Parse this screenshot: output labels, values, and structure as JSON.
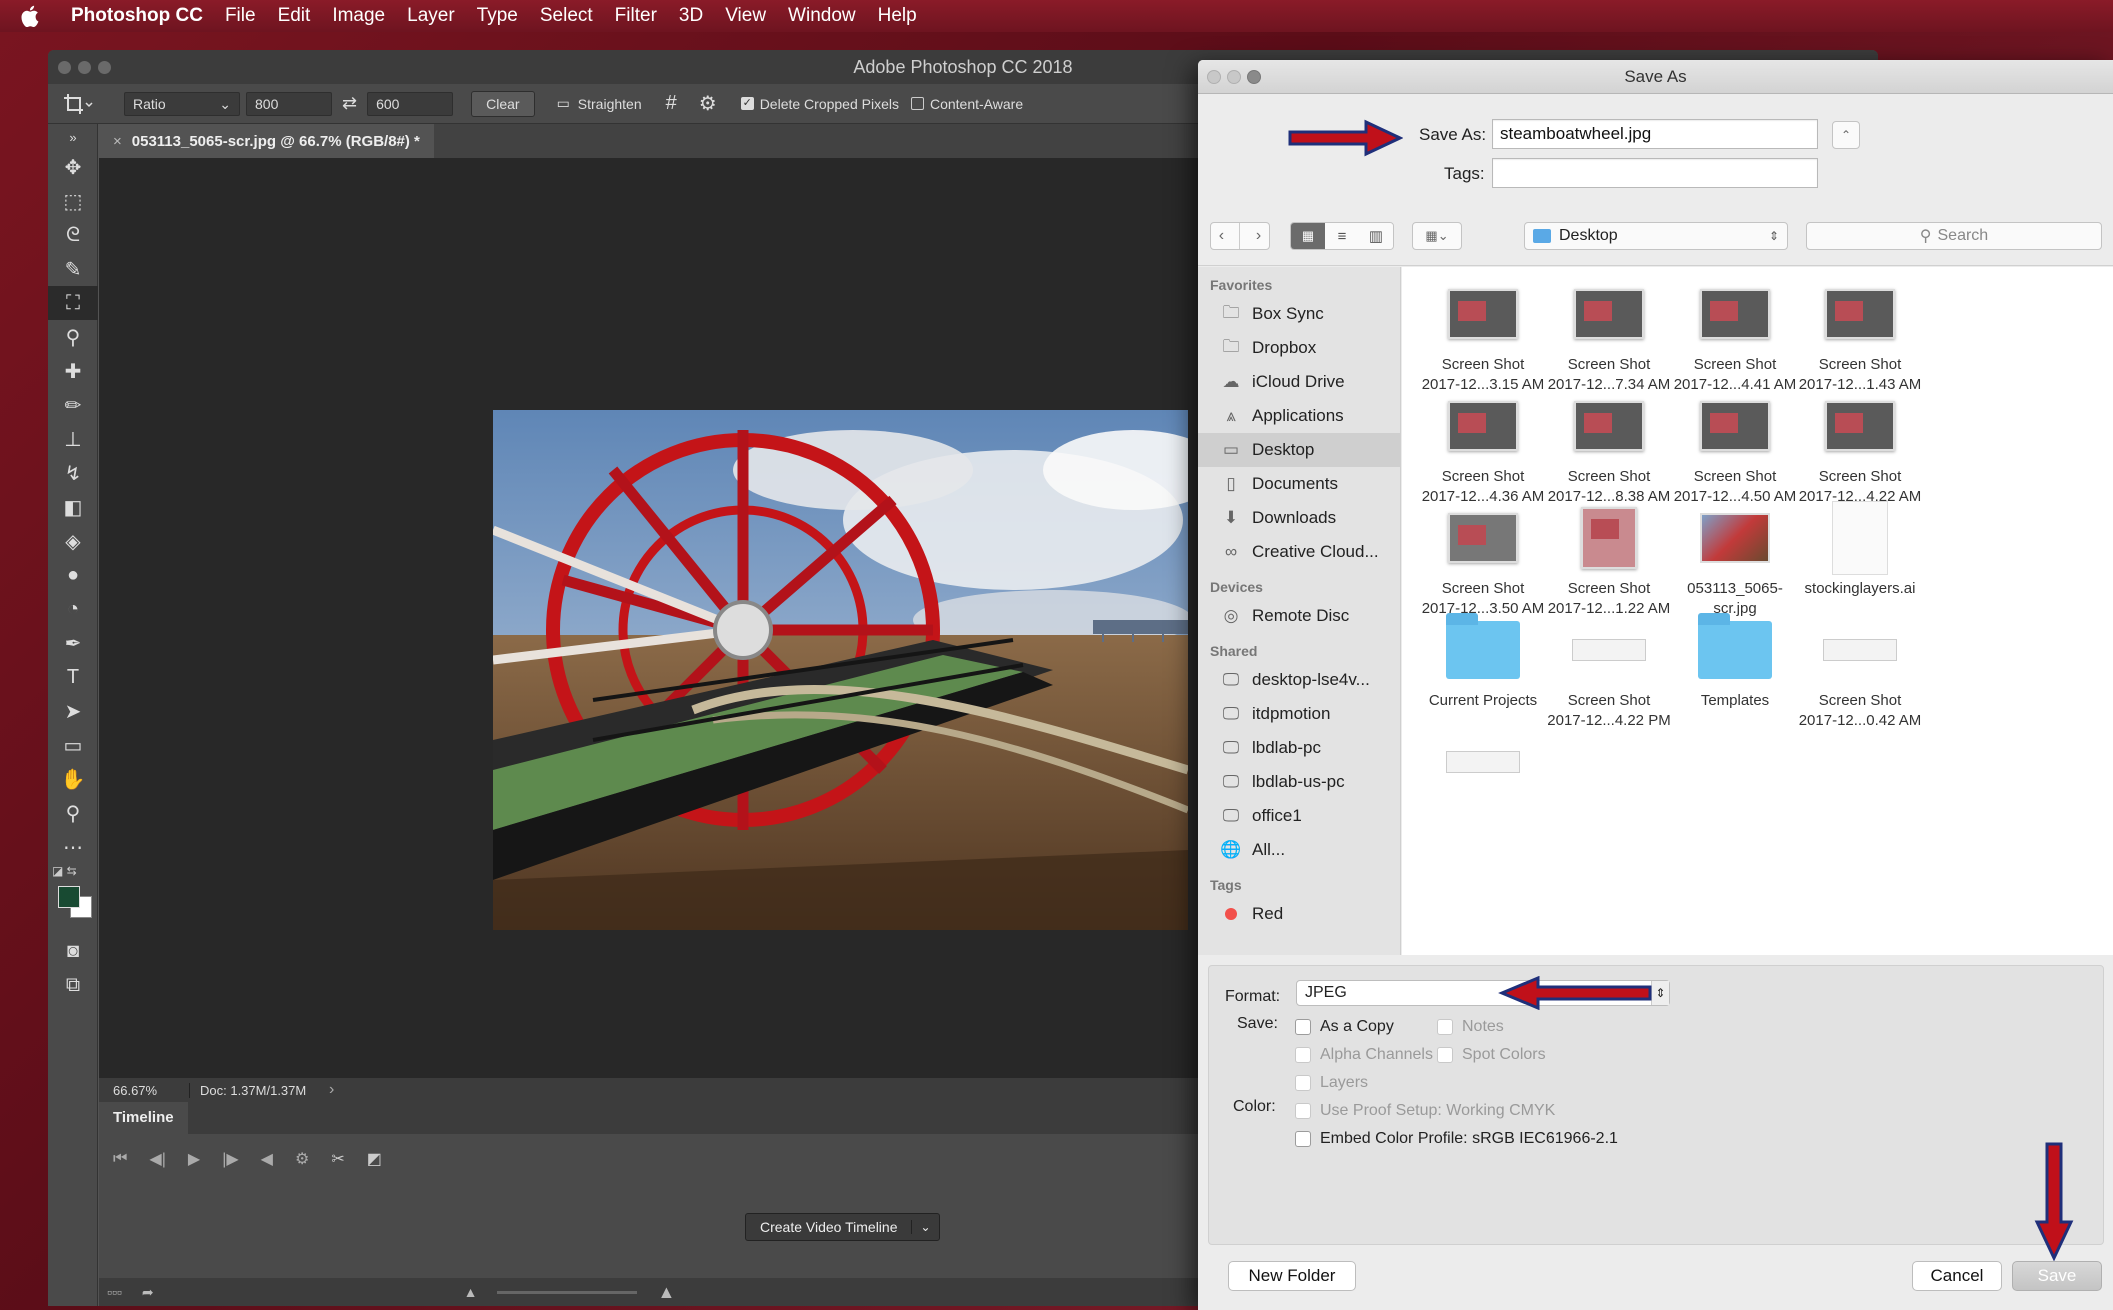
{
  "menubar": {
    "items": [
      "Photoshop CC",
      "File",
      "Edit",
      "Image",
      "Layer",
      "Type",
      "Select",
      "Filter",
      "3D",
      "View",
      "Window",
      "Help"
    ]
  },
  "photoshop": {
    "window_title": "Adobe Photoshop CC 2018",
    "options": {
      "ratio": "Ratio",
      "width": "800",
      "height": "600",
      "clear": "Clear",
      "straighten": "Straighten",
      "delete_cropped": "Delete Cropped Pixels",
      "content_aware": "Content-Aware"
    },
    "doc_tab": "053113_5065-scr.jpg @ 66.7% (RGB/8#) *",
    "status": {
      "zoom": "66.67%",
      "doc": "Doc: 1.37M/1.37M"
    },
    "timeline": {
      "tab": "Timeline",
      "create_button": "Create Video Timeline"
    }
  },
  "dialog": {
    "title": "Save As",
    "save_as_label": "Save As:",
    "filename": "steamboatwheel.jpg",
    "tags_label": "Tags:",
    "tags_value": "",
    "location": "Desktop",
    "search_placeholder": "Search",
    "sidebar": {
      "favorites_heading": "Favorites",
      "favorites": [
        "Box Sync",
        "Dropbox",
        "iCloud Drive",
        "Applications",
        "Desktop",
        "Documents",
        "Downloads",
        "Creative Cloud..."
      ],
      "selected": "Desktop",
      "devices_heading": "Devices",
      "devices": [
        "Remote Disc"
      ],
      "shared_heading": "Shared",
      "shared": [
        "desktop-lse4v...",
        "itdpmotion",
        "lbdlab-pc",
        "lbdlab-us-pc",
        "office1",
        "All..."
      ],
      "tags_heading": "Tags",
      "tags": [
        "Red"
      ]
    },
    "files": [
      {
        "name1": "Screen Shot",
        "name2": "2017-12...3.15 AM",
        "kind": "screenshot"
      },
      {
        "name1": "Screen Shot",
        "name2": "2017-12...7.34 AM",
        "kind": "screenshot"
      },
      {
        "name1": "Screen Shot",
        "name2": "2017-12...4.41 AM",
        "kind": "screenshot"
      },
      {
        "name1": "Screen Shot",
        "name2": "2017-12...1.43 AM",
        "kind": "screenshot"
      },
      {
        "name1": "Screen Shot",
        "name2": "2017-12...4.36 AM",
        "kind": "screenshot"
      },
      {
        "name1": "Screen Shot",
        "name2": "2017-12...8.38 AM",
        "kind": "screenshot"
      },
      {
        "name1": "Screen Shot",
        "name2": "2017-12...4.50 AM",
        "kind": "screenshot"
      },
      {
        "name1": "Screen Shot",
        "name2": "2017-12...4.22 AM",
        "kind": "screenshot"
      },
      {
        "name1": "Screen Shot",
        "name2": "2017-12...3.50 AM",
        "kind": "screenshot"
      },
      {
        "name1": "Screen Shot",
        "name2": "2017-12...1.22 AM",
        "kind": "screenshot"
      },
      {
        "name1": "053113_5065-",
        "name2": "scr.jpg",
        "kind": "photo"
      },
      {
        "name1": "stockinglayers.ai",
        "name2": "",
        "kind": "ai"
      },
      {
        "name1": "Current Projects",
        "name2": "",
        "kind": "folder"
      },
      {
        "name1": "Screen Shot",
        "name2": "2017-12...4.22 PM",
        "kind": "flat"
      },
      {
        "name1": "Templates",
        "name2": "",
        "kind": "folder"
      },
      {
        "name1": "Screen Shot",
        "name2": "2017-12...0.42 AM",
        "kind": "flat"
      }
    ],
    "format_label": "Format:",
    "format_value": "JPEG",
    "save_label": "Save:",
    "checkboxes": {
      "as_copy": "As a Copy",
      "notes": "Notes",
      "alpha": "Alpha Channels",
      "spot": "Spot Colors",
      "layers": "Layers"
    },
    "color_label": "Color:",
    "use_proof": "Use Proof Setup:  Working CMYK",
    "embed_profile": "Embed Color Profile:  sRGB IEC61966-2.1",
    "new_folder": "New Folder",
    "cancel": "Cancel",
    "save": "Save"
  },
  "colors": {
    "annotation_arrow": "#c0101a",
    "arrow_outline": "#1f2f7a",
    "tag_red": "#f2504b"
  }
}
